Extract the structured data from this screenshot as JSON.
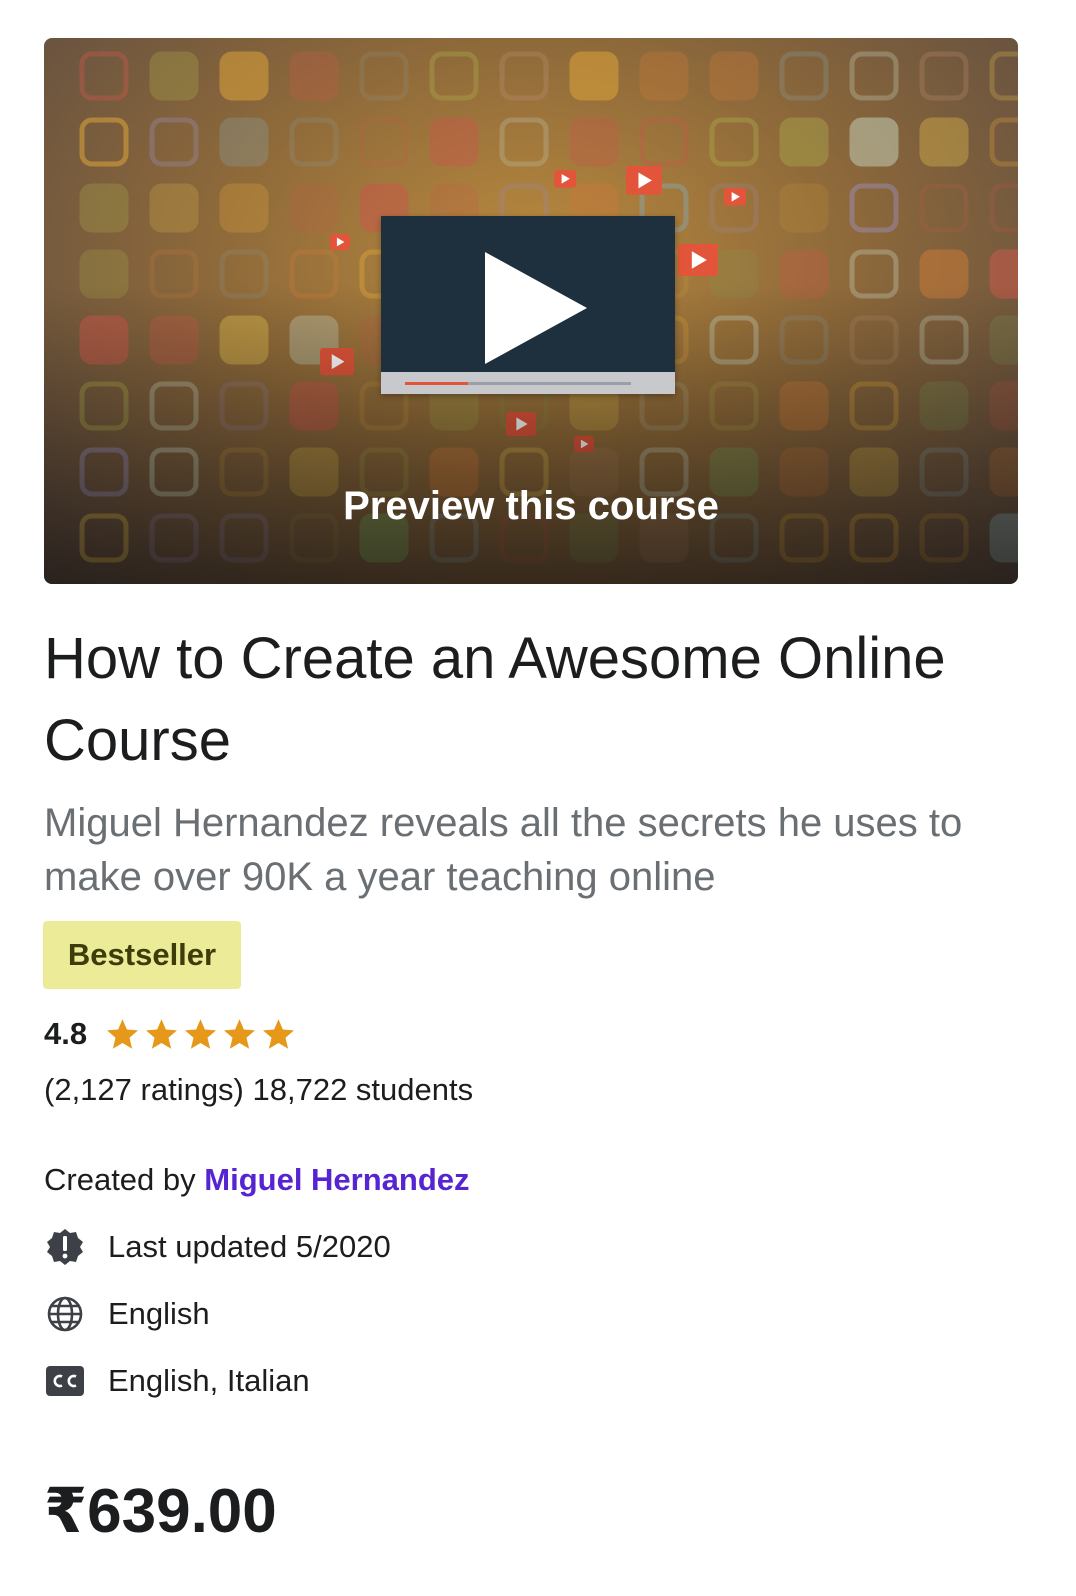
{
  "preview": {
    "label": "Preview this course"
  },
  "course": {
    "title": "How to Create an Awesome Online Course",
    "subtitle": "Miguel Hernandez reveals all the secrets he uses to make over 90K a year teaching online",
    "badge": "Bestseller",
    "rating": "4.8",
    "stars": 5,
    "counts": "(2,127 ratings) 18,722 students",
    "created_prefix": "Created by",
    "instructor": "Miguel Hernandez",
    "last_updated": "Last updated 5/2020",
    "language": "English",
    "captions": "English, Italian",
    "price": "₹639.00"
  },
  "colors": {
    "accent": "#5624d0",
    "badge_bg": "#eceb98",
    "star": "#e59819",
    "text": "#1c1d1f",
    "muted": "#6a6f73"
  },
  "icons": {
    "updated": "alert-badge-icon",
    "language": "globe-icon",
    "captions": "closed-captions-icon",
    "play": "play-icon",
    "star": "star-icon"
  }
}
